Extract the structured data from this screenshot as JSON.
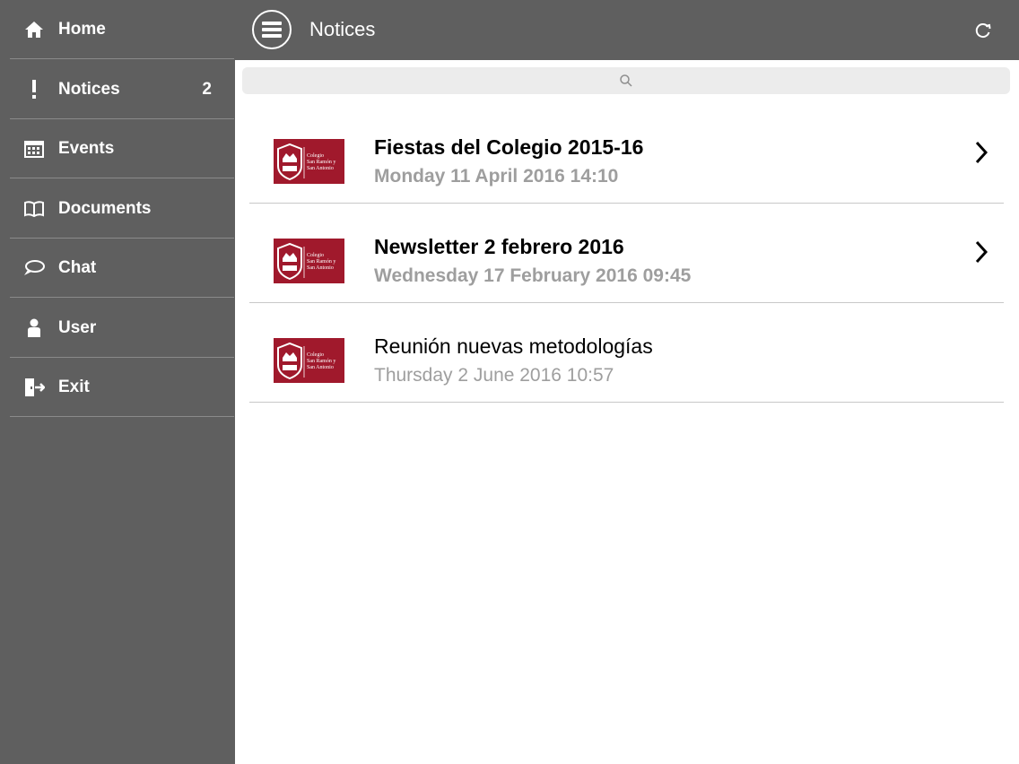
{
  "app": {
    "title": "Notices"
  },
  "sidebar": {
    "items": [
      {
        "label": "Home",
        "icon": "home-icon"
      },
      {
        "label": "Notices",
        "icon": "exclamation-icon",
        "badge": "2"
      },
      {
        "label": "Events",
        "icon": "calendar-icon"
      },
      {
        "label": "Documents",
        "icon": "book-icon"
      },
      {
        "label": "Chat",
        "icon": "chat-icon"
      },
      {
        "label": "User",
        "icon": "user-icon"
      },
      {
        "label": "Exit",
        "icon": "exit-icon"
      }
    ]
  },
  "search": {
    "icon": "search-icon"
  },
  "logo": {
    "line1": "Colegio",
    "line2": "San Ramón y",
    "line3": "San Antonio"
  },
  "notices": [
    {
      "title": "Fiestas del Colegio 2015-16",
      "date": "Monday 11 April 2016 14:10",
      "unread": true
    },
    {
      "title": "Newsletter 2 febrero 2016",
      "date": "Wednesday 17 February 2016 09:45",
      "unread": true
    },
    {
      "title": "Reunión nuevas metodologías",
      "date": "Thursday 2 June 2016 10:57",
      "unread": false
    }
  ],
  "colors": {
    "bar": "#5f5f5f",
    "brand": "#a0192c",
    "date": "#9e9e9e"
  }
}
